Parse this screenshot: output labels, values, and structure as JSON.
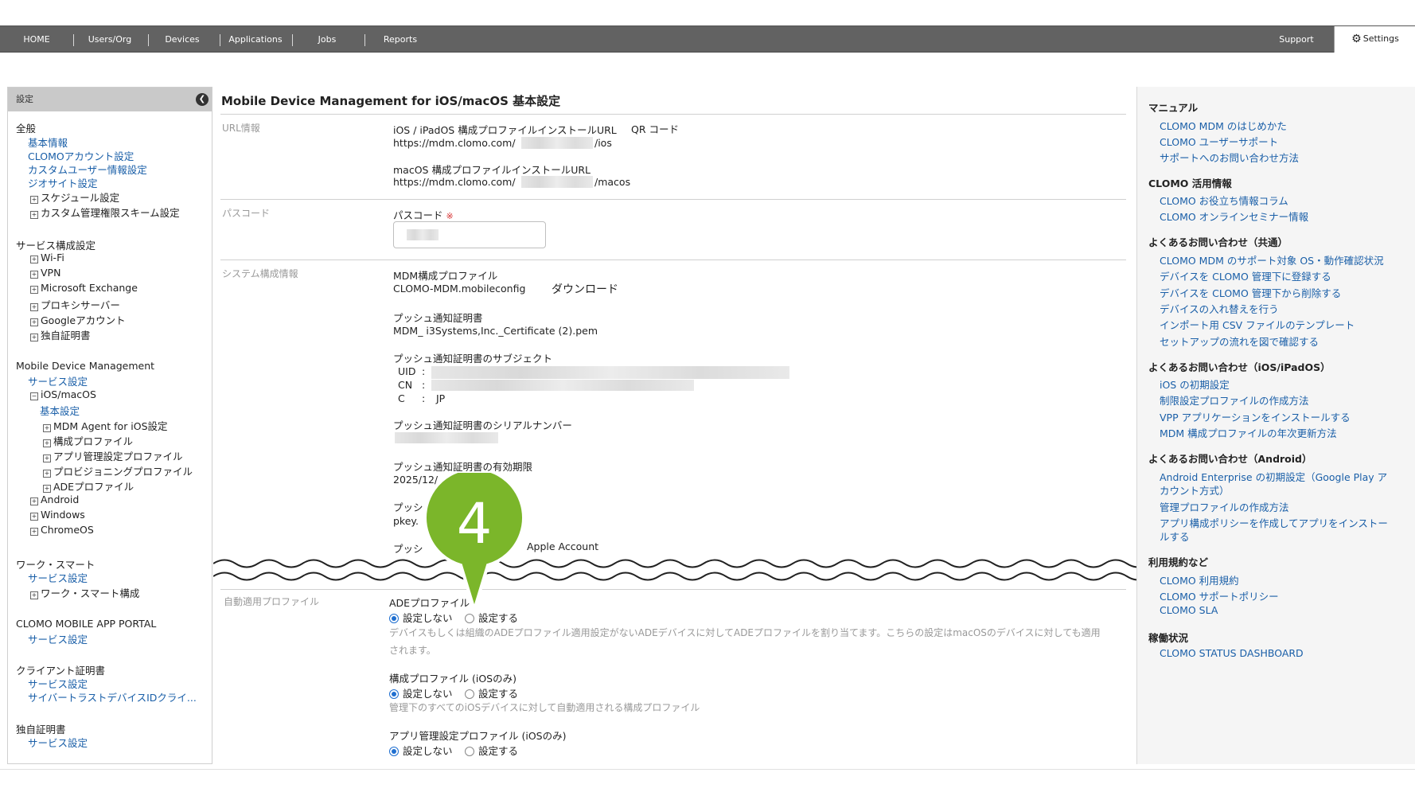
{
  "nav": {
    "items": [
      "HOME",
      "Users/Org",
      "Devices",
      "Applications",
      "Jobs",
      "Reports"
    ],
    "support": "Support",
    "settings": "Settings"
  },
  "sidebar": {
    "header": "設定",
    "general": {
      "title": "全般",
      "basic": "基本情報",
      "account": "CLOMOアカウント設定",
      "custom_user": "カスタムユーザー情報設定",
      "geosite": "ジオサイト設定",
      "schedule": "スケジュール設定",
      "custom_perm": "カスタム管理権限スキーム設定"
    },
    "service_config": {
      "title": "サービス構成設定",
      "wifi": "Wi-Fi",
      "vpn": "VPN",
      "exchange": "Microsoft Exchange",
      "proxy": "プロキシサーバー",
      "google": "Googleアカウント",
      "cert": "独自証明書"
    },
    "mdm": {
      "title": "Mobile Device Management",
      "service": "サービス設定",
      "ios": "iOS/macOS",
      "basic": "基本設定",
      "agent": "MDM Agent for iOS設定",
      "config_profile": "構成プロファイル",
      "app_profile": "アプリ管理設定プロファイル",
      "provisioning": "プロビジョニングプロファイル",
      "ade": "ADEプロファイル",
      "android": "Android",
      "windows": "Windows",
      "chromeos": "ChromeOS"
    },
    "work_smart": {
      "title": "ワーク・スマート",
      "service": "サービス設定",
      "config": "ワーク・スマート構成"
    },
    "portal": {
      "title": "CLOMO MOBILE APP PORTAL",
      "service": "サービス設定"
    },
    "client_cert": {
      "title": "クライアント証明書",
      "service": "サービス設定",
      "cyber": "サイバートラストデバイスIDクライ..."
    },
    "own_cert": {
      "title": "独自証明書",
      "service": "サービス設定"
    }
  },
  "main": {
    "title": "Mobile Device Management for iOS/macOS 基本設定",
    "url_section": {
      "label": "URL情報",
      "ios_label": "iOS / iPadOS 構成プロファイルインストールURL",
      "qr": "QR コード",
      "ios_prefix": "https://mdm.clomo.com/",
      "ios_suffix": "/ios",
      "mac_label": "macOS 構成プロファイルインストールURL",
      "mac_prefix": "https://mdm.clomo.com/",
      "mac_suffix": "/macos"
    },
    "passcode_section": {
      "label": "パスコード",
      "field_label": "パスコード",
      "required": "※"
    },
    "system_section": {
      "label": "システム構成情報",
      "profile_label": "MDM構成プロファイル",
      "profile_file": "CLOMO-MDM.mobileconfig",
      "download": "ダウンロード",
      "push_cert_label": "プッシュ通知証明書",
      "push_cert_file": "MDM_ i3Systems,Inc._Certificate (2).pem",
      "subject_label": "プッシュ通知証明書のサブジェクト",
      "uid": "UID",
      "cn": "CN",
      "c": "C",
      "colon": ":",
      "c_value": "JP",
      "serial_label": "プッシュ通知証明書のシリアルナンバー",
      "expiry_label": "プッシュ通知証明書の有効期限",
      "expiry_value": "2025/12/",
      "key_label": "プッシ",
      "key_value": "pkey.",
      "account_prefix": "プッシ",
      "account_suffix": "Apple Account"
    },
    "auto_section": {
      "label": "自動適用プロファイル",
      "ade_label": "ADEプロファイル",
      "opt_off": "設定しない",
      "opt_on": "設定する",
      "ade_help1": "デバイスもしくは組織のADEプロファイル適用設定がないADEデバイスに対してADEプロファイルを割り当てます。こちらの設定はmacOSのデバイスに対しても適用",
      "ade_help2": "されます。",
      "config_label": "構成プロファイル (iOSのみ)",
      "config_help": "管理下のすべてのiOSデバイスに対して自動適用される構成プロファイル",
      "app_label": "アプリ管理設定プロファイル (iOSのみ)"
    },
    "step_badge": "4"
  },
  "right": {
    "manual": {
      "title": "マニュアル",
      "links": [
        "CLOMO MDM のはじめかた",
        "CLOMO ユーザーサポート",
        "サポートへのお問い合わせ方法"
      ]
    },
    "usage": {
      "title": "CLOMO 活用情報",
      "links": [
        "CLOMO お役立ち情報コラム",
        "CLOMO オンラインセミナー情報"
      ]
    },
    "faq_common": {
      "title": "よくあるお問い合わせ（共通）",
      "links": [
        "CLOMO MDM のサポート対象 OS・動作確認状況",
        "デバイスを CLOMO 管理下に登録する",
        "デバイスを CLOMO 管理下から削除する",
        "デバイスの入れ替えを行う",
        "インポート用 CSV ファイルのテンプレート",
        "セットアップの流れを図で確認する"
      ]
    },
    "faq_ios": {
      "title": "よくあるお問い合わせ（iOS/iPadOS）",
      "links": [
        "iOS の初期設定",
        "制限設定プロファイルの作成方法",
        "VPP アプリケーションをインストールする",
        "MDM 構成プロファイルの年次更新方法"
      ]
    },
    "faq_android": {
      "title": "よくあるお問い合わせ（Android）",
      "links": [
        "Android Enterprise の初期設定（Google Play ア",
        "カウント方式）",
        "管理プロファイルの作成方法",
        "アプリ構成ポリシーを作成してアプリをインストー",
        "ルする"
      ]
    },
    "terms": {
      "title": "利用規約など",
      "links": [
        "CLOMO 利用規約",
        "CLOMO サポートポリシー",
        "CLOMO SLA"
      ]
    },
    "status": {
      "title": "稼働状況",
      "links": [
        "CLOMO STATUS DASHBOARD"
      ]
    }
  }
}
